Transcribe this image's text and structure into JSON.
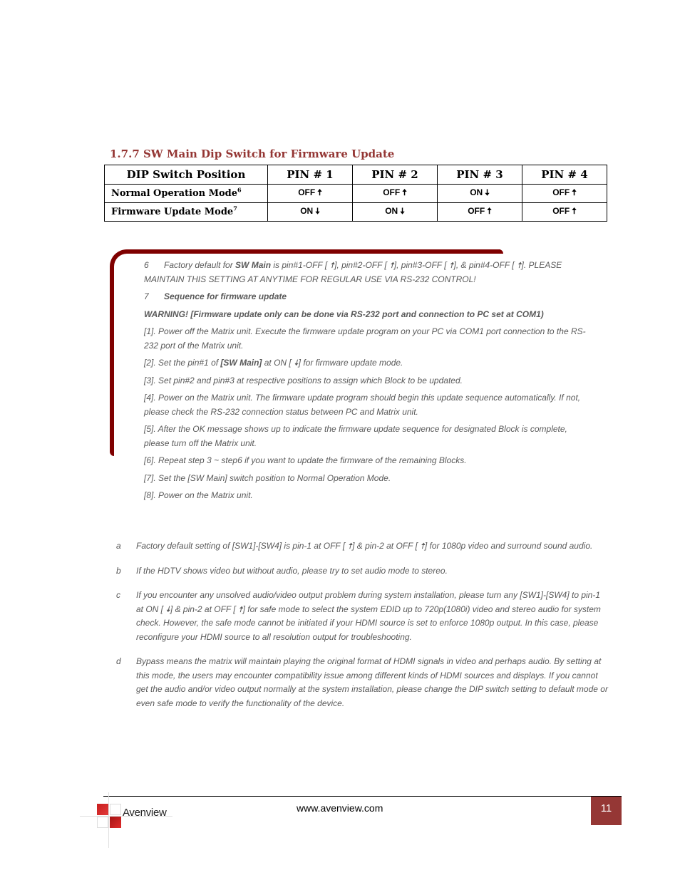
{
  "section": {
    "title": "1.7.7 SW Main Dip Switch for Firmware Update"
  },
  "table": {
    "headers": [
      "DIP Switch Position",
      "PIN # 1",
      "PIN # 2",
      "PIN # 3",
      "PIN # 4"
    ],
    "rows": [
      {
        "mode": "Normal Operation Mode",
        "footnote_ref": "6",
        "pins": [
          {
            "state": "OFF",
            "arrow": "🠅",
            "direction": "up"
          },
          {
            "state": "OFF",
            "arrow": "🠅",
            "direction": "up"
          },
          {
            "state": "ON",
            "arrow": "🠇",
            "direction": "down"
          },
          {
            "state": "OFF",
            "arrow": "🠅",
            "direction": "up"
          }
        ]
      },
      {
        "mode": "Firmware Update Mode",
        "footnote_ref": "7",
        "pins": [
          {
            "state": "ON",
            "arrow": "🠇",
            "direction": "down"
          },
          {
            "state": "ON",
            "arrow": "🠇",
            "direction": "down"
          },
          {
            "state": "OFF",
            "arrow": "🠅",
            "direction": "up"
          },
          {
            "state": "OFF",
            "arrow": "🠅",
            "direction": "up"
          }
        ]
      }
    ]
  },
  "notes": {
    "note6_num": "6",
    "note6_pre": "Factory default for ",
    "note6_bold": "SW Main",
    "note6_post": " is pin#1-OFF [ 🠅], pin#2-OFF [ 🠅], pin#3-OFF [ 🠅], & pin#4-OFF [ 🠅]. PLEASE MAINTAIN THIS SETTING AT ANYTIME FOR REGULAR USE VIA RS-232 CONTROL!",
    "note7_num": "7",
    "note7_title": "Sequence for firmware update",
    "warning": "WARNING! [Firmware update only can be done via RS-232 port and connection to PC set at COM1)",
    "steps": [
      "[1].   Power off the Matrix unit. Execute the firmware update program on your PC via COM1 port connection to the RS-232 port of the Matrix unit.",
      "[2].   Set the pin#1 of ",
      "[3].   Set pin#2 and pin#3 at respective positions to assign which Block to be updated.",
      "[4].   Power on the Matrix unit. The firmware update program should begin this update sequence automatically. If not, please check the RS-232 connection status between PC and Matrix unit.",
      "[5].   After the OK message shows up to indicate the firmware update sequence for designated Block is complete, please turn off the Matrix unit.",
      "[6].   Repeat step 3 ~ step6 if you want to update the firmware of the remaining Blocks.",
      "[7].   Set the [SW Main] switch position to Normal Operation Mode.",
      "[8].   Power on the Matrix unit."
    ],
    "step2_bold": "[SW Main]",
    "step2_post": " at ON [ 🠇] for firmware update mode."
  },
  "footnotes": [
    {
      "letter": "a",
      "text": "Factory default setting of [SW1]-[SW4] is pin-1 at OFF [ 🠅] & pin-2 at OFF [ 🠅] for 1080p video and surround sound audio."
    },
    {
      "letter": "b",
      "text": "If the HDTV shows video but without audio, please try to set audio mode to stereo."
    },
    {
      "letter": "c",
      "text": "If you encounter any unsolved audio/video output problem during system installation, please turn any [SW1]-[SW4] to pin-1 at ON [ 🠇] & pin-2 at OFF [ 🠅] for safe mode to select the system EDID up to 720p(1080i) video and stereo audio for system check. However, the safe mode cannot be initiated if your HDMI source is set to enforce 1080p output. In this case, please reconfigure your HDMI source to all resolution output for troubleshooting."
    },
    {
      "letter": "d",
      "text": "Bypass means the matrix will maintain playing the original format of HDMI signals in video and perhaps audio. By setting at this mode, the users may encounter compatibility issue among different kinds of HDMI sources and displays. If you cannot get the audio and/or video output normally at the system installation, please change the DIP switch setting to default mode or even safe mode to verify the functionality of the device."
    }
  ],
  "footer": {
    "logo_text": "Avenview",
    "url": "www.avenview.com",
    "page_number": "11",
    "accent_color": "#953735"
  }
}
